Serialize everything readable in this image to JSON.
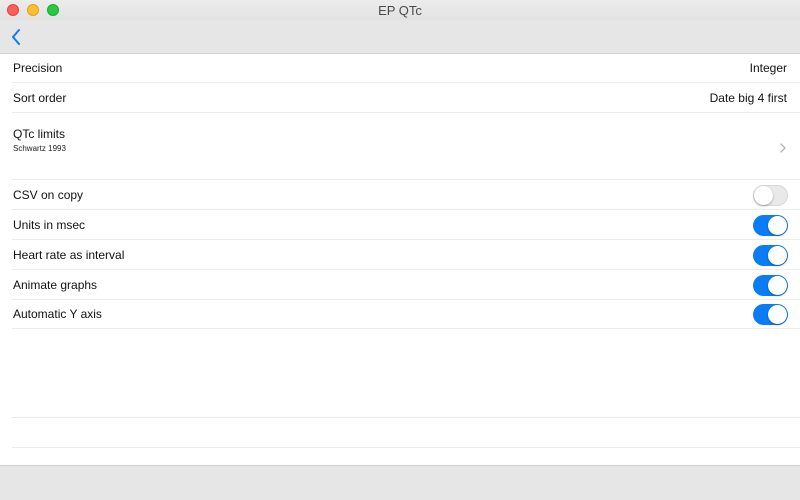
{
  "window": {
    "title": "EP QTc"
  },
  "settings": {
    "precision": {
      "label": "Precision",
      "value": "Integer"
    },
    "sort_order": {
      "label": "Sort order",
      "value": "Date big 4 first"
    },
    "qtc_limits": {
      "label": "QTc limits",
      "subtitle": "Schwartz 1993"
    },
    "toggles": [
      {
        "label": "CSV on copy",
        "on": false
      },
      {
        "label": "Units in msec",
        "on": true
      },
      {
        "label": "Heart rate as interval",
        "on": true
      },
      {
        "label": "Animate graphs",
        "on": true
      },
      {
        "label": "Automatic Y axis",
        "on": true
      }
    ]
  },
  "colors": {
    "accent": "#0a7cf5",
    "toggle_off": "#e9e9e9"
  },
  "icons": {
    "back": "chevron-left-icon",
    "disclosure": "chevron-right-icon"
  }
}
